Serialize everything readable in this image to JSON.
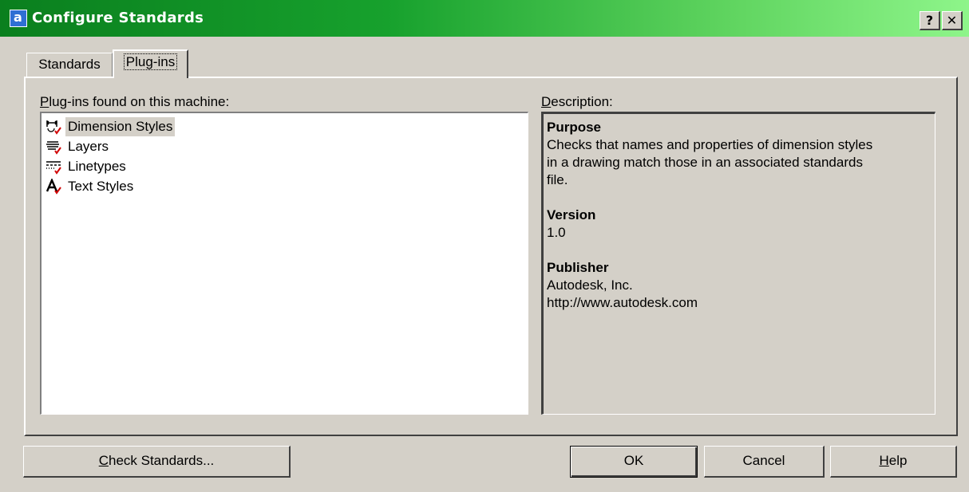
{
  "window": {
    "title": "Configure Standards",
    "help_glyph": "?",
    "close_glyph": "✕"
  },
  "tabs": [
    {
      "label": "Standards"
    },
    {
      "label": "Plug-ins"
    }
  ],
  "plugins_label_ul": "P",
  "plugins_label_rest": "lug-ins found on this machine:",
  "description_label_ul": "D",
  "description_label_rest": "escription:",
  "plugins": [
    {
      "label": "Dimension Styles",
      "icon": "dimension-styles-icon",
      "selected": true
    },
    {
      "label": "Layers",
      "icon": "layers-icon"
    },
    {
      "label": "Linetypes",
      "icon": "linetypes-icon"
    },
    {
      "label": "Text Styles",
      "icon": "text-styles-icon"
    }
  ],
  "description": {
    "purpose_heading": "Purpose",
    "purpose_line1": "Checks that names and properties of dimension styles",
    "purpose_line2": "in a drawing match those in an associated standards",
    "purpose_line3": "file.",
    "version_heading": "Version",
    "version_value": "1.0",
    "publisher_heading": "Publisher",
    "publisher_name": "Autodesk, Inc.",
    "publisher_url": "http://www.autodesk.com"
  },
  "buttons": {
    "check_ul": "C",
    "check_rest": "heck Standards...",
    "ok": "OK",
    "cancel": "Cancel",
    "help_ul": "H",
    "help_rest": "elp"
  }
}
